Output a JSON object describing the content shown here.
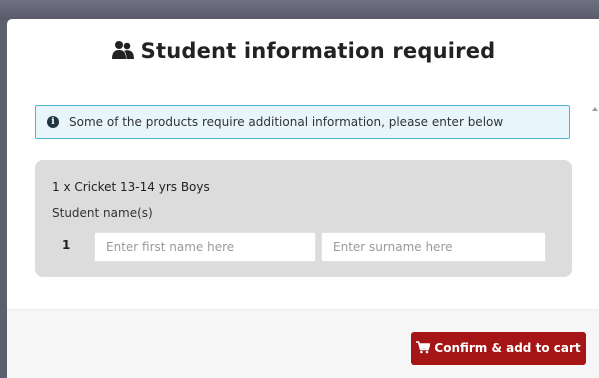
{
  "modal": {
    "title": "Student information required",
    "title_icon": "users-icon"
  },
  "alert": {
    "icon": "info-circle-icon",
    "icon_glyph": "i",
    "text": "Some of the products require additional information, please enter below"
  },
  "product": {
    "title": "1 x Cricket 13-14 yrs Boys",
    "names_label": "Student name(s)",
    "rows": [
      {
        "number": "1",
        "first_name_value": "",
        "first_name_placeholder": "Enter first name here",
        "surname_value": "",
        "surname_placeholder": "Enter surname here"
      }
    ]
  },
  "footer": {
    "confirm_label": "Confirm & add to cart",
    "confirm_icon": "cart-icon"
  },
  "colors": {
    "accent": "#a51515",
    "alert_border": "#51b3d4",
    "alert_bg": "#e8f6fb",
    "panel_bg": "#dcdcdc"
  }
}
